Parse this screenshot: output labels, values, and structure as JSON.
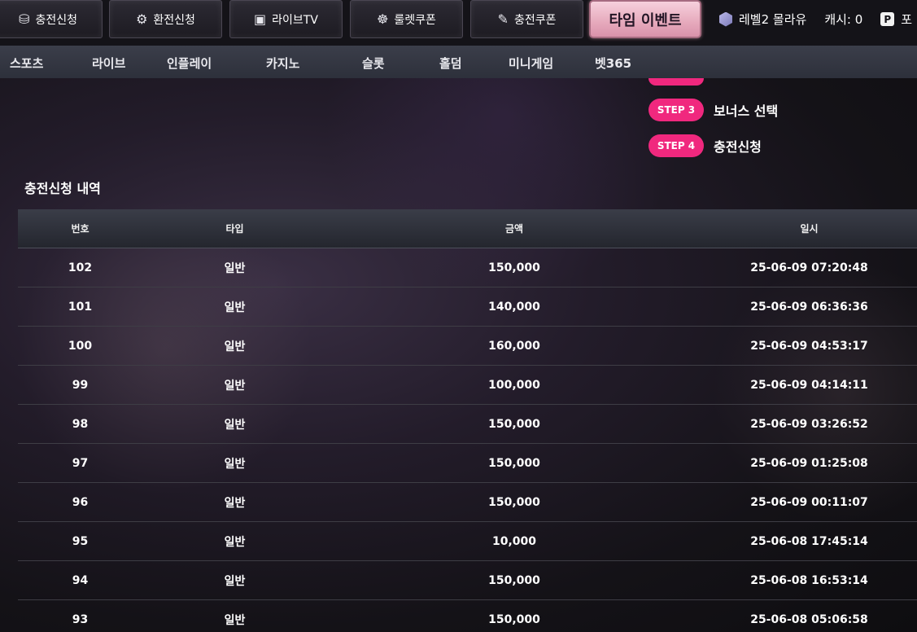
{
  "topbar": {
    "buttons": [
      {
        "label": "충전신청",
        "icon": "coins-icon"
      },
      {
        "label": "환전신청",
        "icon": "exchange-icon"
      },
      {
        "label": "라이브TV",
        "icon": "live-tv-icon"
      },
      {
        "label": "룰렛쿠폰",
        "icon": "roulette-icon"
      },
      {
        "label": "충전쿠폰",
        "icon": "ticket-icon"
      }
    ],
    "event_button": "타임 이벤트",
    "user_level": "레벨2 몰라유",
    "cash": "캐시: 0",
    "point_label": "포",
    "point_icon_letter": "P"
  },
  "nav": {
    "items": [
      "스포츠",
      "라이브",
      "인플레이",
      "카지노",
      "슬롯",
      "홀덤",
      "미니게임",
      "벳365"
    ]
  },
  "steps": [
    {
      "badge": "STEP 3",
      "text": "보너스 선택"
    },
    {
      "badge": "STEP 4",
      "text": "충전신청"
    }
  ],
  "history": {
    "title": "충전신청 내역",
    "columns": [
      "번호",
      "타입",
      "금액",
      "일시"
    ],
    "rows": [
      [
        "102",
        "일반",
        "150,000",
        "25-06-09 07:20:48"
      ],
      [
        "101",
        "일반",
        "140,000",
        "25-06-09 06:36:36"
      ],
      [
        "100",
        "일반",
        "160,000",
        "25-06-09 04:53:17"
      ],
      [
        "99",
        "일반",
        "100,000",
        "25-06-09 04:14:11"
      ],
      [
        "98",
        "일반",
        "150,000",
        "25-06-09 03:26:52"
      ],
      [
        "97",
        "일반",
        "150,000",
        "25-06-09 01:25:08"
      ],
      [
        "96",
        "일반",
        "150,000",
        "25-06-09 00:11:07"
      ],
      [
        "95",
        "일반",
        "10,000",
        "25-06-08 17:45:14"
      ],
      [
        "94",
        "일반",
        "150,000",
        "25-06-08 16:53:14"
      ],
      [
        "93",
        "일반",
        "150,000",
        "25-06-08 05:06:58"
      ]
    ]
  },
  "colors": {
    "accent_pink": "#f0287e",
    "event_pink": "#e6a9bc",
    "nav_bg": "#3b3e4a"
  }
}
